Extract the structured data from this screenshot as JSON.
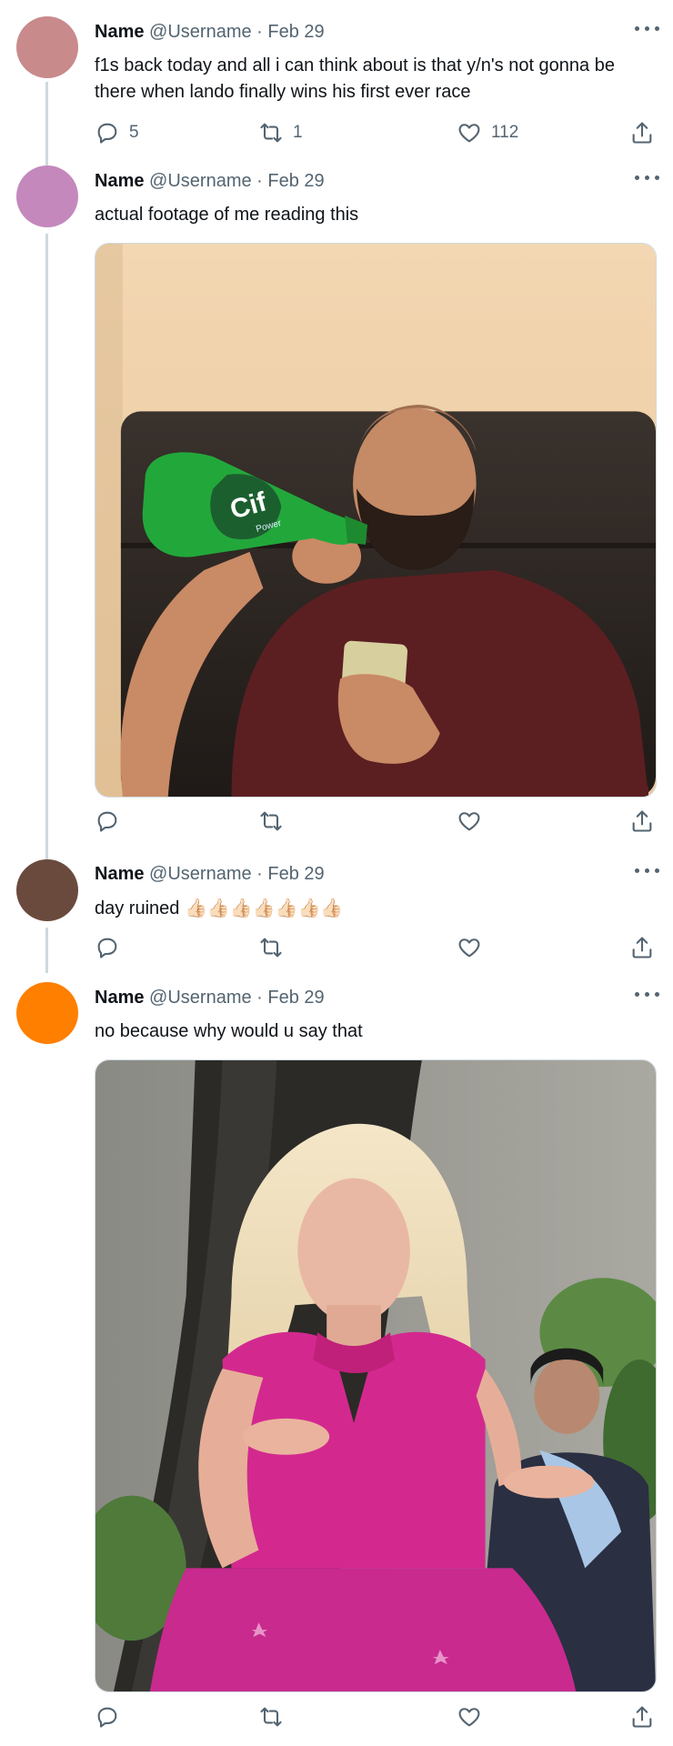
{
  "tweets": [
    {
      "name": "Name",
      "meta": "@Username · Feb 29",
      "text": "f1s back today and all i can think about is that y/n's not gonna be there when lando finally wins his first ever race",
      "reply_count": "5",
      "retweet_count": "1",
      "like_count": "112",
      "avatar_color": "#c98a8c"
    },
    {
      "name": "Name",
      "meta": "@Username · Feb 29",
      "text": "actual footage of me reading this",
      "avatar_color": "#c488bd",
      "media_label": "Cif Power"
    },
    {
      "name": "Name",
      "meta": "@Username · Feb 29",
      "text": "day ruined 👍🏻👍🏻👍🏻👍🏻👍🏻👍🏻👍🏻",
      "avatar_color": "#6b4a3e"
    },
    {
      "name": "Name",
      "meta": "@Username · Feb 29",
      "text": "no because why would u say that",
      "avatar_color": "#ff7f00"
    }
  ],
  "icons": {
    "reply": "reply-icon",
    "retweet": "retweet-icon",
    "like": "heart-icon",
    "share": "share-icon",
    "more": "more-icon"
  }
}
